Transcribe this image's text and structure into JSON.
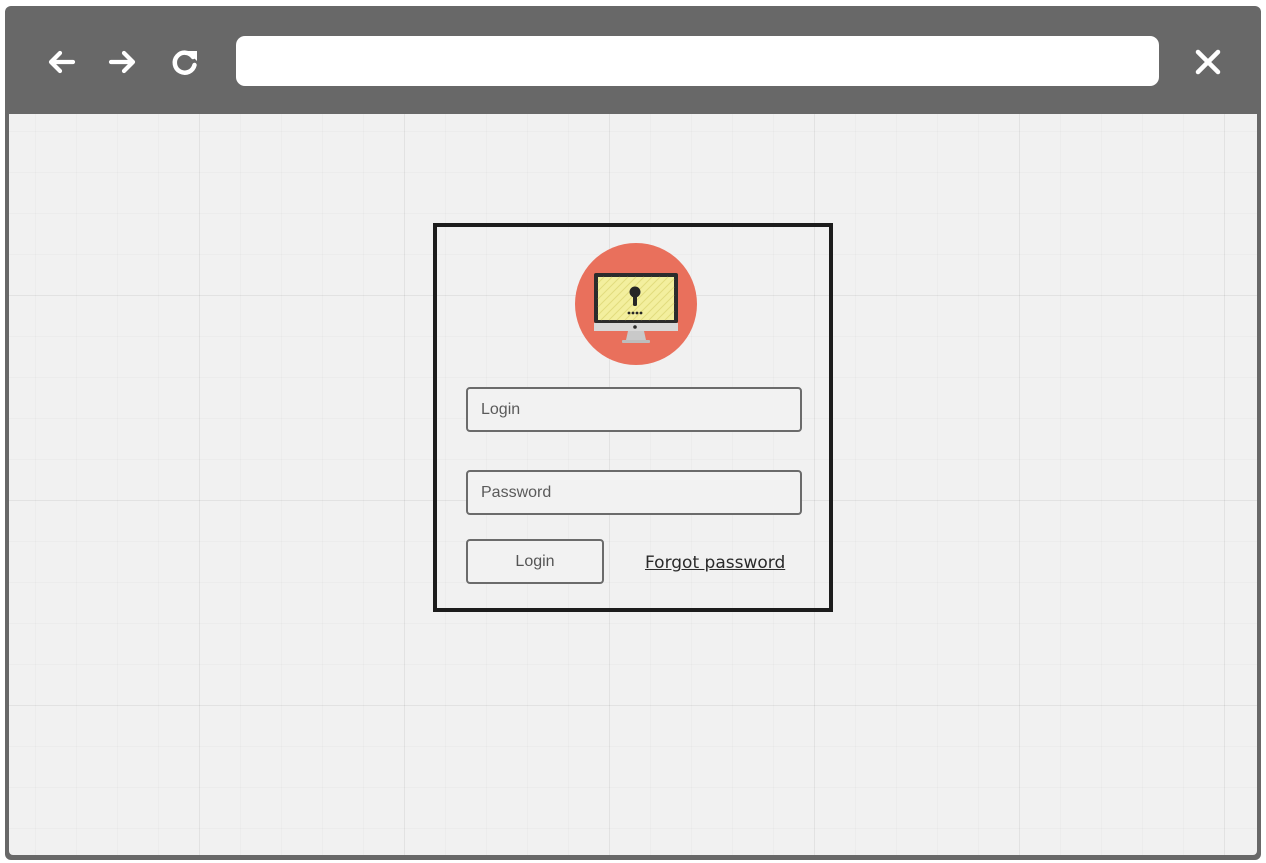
{
  "browser": {
    "back_icon": "arrow-left-icon",
    "forward_icon": "arrow-right-icon",
    "reload_icon": "reload-icon",
    "close_icon": "close-icon",
    "address_value": ""
  },
  "login_form": {
    "avatar_icon": "monitor-lock-icon",
    "login_placeholder": "Login",
    "password_placeholder": "Password",
    "login_button_label": "Login",
    "forgot_password_label": "Forgot password"
  },
  "colors": {
    "chrome": "#686868",
    "canvas": "#f1f1f1",
    "avatar_circle": "#e9705c",
    "screen": "#f3ef9e"
  }
}
